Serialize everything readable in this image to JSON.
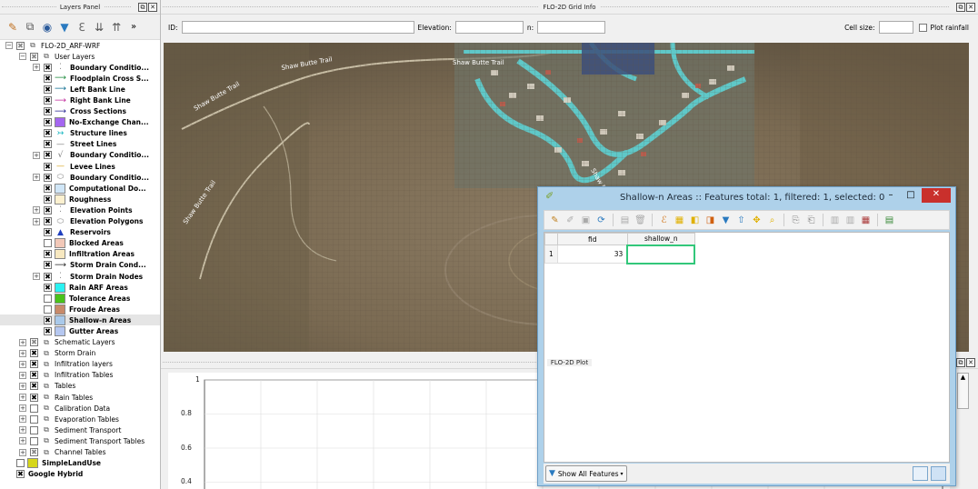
{
  "layers_panel": {
    "title": "Layers Panel",
    "tree": [
      {
        "label": "FLO-2D_ARF-WRF",
        "level": 0,
        "expander": "⊟",
        "check": "☒",
        "kind": "group",
        "bold": false
      },
      {
        "label": "User Layers",
        "level": 1,
        "expander": "⊟",
        "check": "☒",
        "kind": "group",
        "bold": false
      },
      {
        "label": "Boundary Conditio...",
        "level": 2,
        "expander": "⊞",
        "check": "✖",
        "kind": "layer",
        "symbol": "⁚",
        "symbol_color": "#888888",
        "bold": true
      },
      {
        "label": "Floodplain Cross S...",
        "level": 2,
        "expander": "",
        "check": "✖",
        "kind": "layer",
        "symbol": "⟶",
        "symbol_color": "#1a8a3a",
        "bold": true
      },
      {
        "label": "Left Bank Line",
        "level": 2,
        "expander": "",
        "check": "✖",
        "kind": "layer",
        "symbol": "⟶",
        "symbol_color": "#0b6b8f",
        "bold": true
      },
      {
        "label": "Right Bank Line",
        "level": 2,
        "expander": "",
        "check": "✖",
        "kind": "layer",
        "symbol": "⟶",
        "symbol_color": "#c0259a",
        "bold": true
      },
      {
        "label": "Cross Sections",
        "level": 2,
        "expander": "",
        "check": "✖",
        "kind": "layer",
        "symbol": "⟶",
        "symbol_color": "#1e1e8c",
        "bold": true
      },
      {
        "label": "No-Exchange Chan...",
        "level": 2,
        "expander": "",
        "check": "✖",
        "kind": "swatch",
        "symbol_color": "#a466f0",
        "bold": true
      },
      {
        "label": "Structure lines",
        "level": 2,
        "expander": "",
        "check": "✖",
        "kind": "layer",
        "symbol": "↣",
        "symbol_color": "#15b5c0",
        "bold": true
      },
      {
        "label": "Street Lines",
        "level": 2,
        "expander": "",
        "check": "✖",
        "kind": "layer",
        "symbol": "—",
        "symbol_color": "#777777",
        "bold": true
      },
      {
        "label": "Boundary Conditio...",
        "level": 2,
        "expander": "⊞",
        "check": "✖",
        "kind": "layer",
        "symbol": "√",
        "symbol_color": "#777777",
        "bold": true
      },
      {
        "label": "Levee Lines",
        "level": 2,
        "expander": "",
        "check": "✖",
        "kind": "layer",
        "symbol": "—",
        "symbol_color": "#d4a017",
        "bold": true
      },
      {
        "label": "Boundary Conditio...",
        "level": 2,
        "expander": "⊞",
        "check": "✖",
        "kind": "layer",
        "symbol": "⬭",
        "symbol_color": "#888888",
        "bold": true
      },
      {
        "label": "Computational Do...",
        "level": 2,
        "expander": "",
        "check": "✖",
        "kind": "swatch",
        "symbol_color": "#d0e6f7",
        "bold": true
      },
      {
        "label": "Roughness",
        "level": 2,
        "expander": "",
        "check": "✖",
        "kind": "swatch",
        "symbol_color": "#fdf1d0",
        "bold": true
      },
      {
        "label": "Elevation Points",
        "level": 2,
        "expander": "⊞",
        "check": "✖",
        "kind": "layer",
        "symbol": "⁚",
        "symbol_color": "#888888",
        "bold": true
      },
      {
        "label": "Elevation Polygons",
        "level": 2,
        "expander": "⊞",
        "check": "✖",
        "kind": "layer",
        "symbol": "⬭",
        "symbol_color": "#888888",
        "bold": true
      },
      {
        "label": "Reservoirs",
        "level": 2,
        "expander": "",
        "check": "✖",
        "kind": "layer",
        "symbol": "▲",
        "symbol_color": "#1f3fbf",
        "bold": true
      },
      {
        "label": "Blocked Areas",
        "level": 2,
        "expander": "",
        "check": "",
        "kind": "swatch",
        "symbol_color": "#f2c8b8",
        "bold": true
      },
      {
        "label": "Infiltration Areas",
        "level": 2,
        "expander": "",
        "check": "✖",
        "kind": "swatch",
        "symbol_color": "#f7e8c0",
        "bold": true
      },
      {
        "label": "Storm Drain Cond...",
        "level": 2,
        "expander": "",
        "check": "✖",
        "kind": "layer",
        "symbol": "⟶",
        "symbol_color": "#222222",
        "bold": true
      },
      {
        "label": "Storm Drain Nodes",
        "level": 2,
        "expander": "⊞",
        "check": "✖",
        "kind": "layer",
        "symbol": "⁚",
        "symbol_color": "#888888",
        "bold": true
      },
      {
        "label": "Rain ARF Areas",
        "level": 2,
        "expander": "",
        "check": "✖",
        "kind": "swatch",
        "symbol_color": "#2af2f2",
        "bold": true
      },
      {
        "label": "Tolerance Areas",
        "level": 2,
        "expander": "",
        "check": "",
        "kind": "swatch",
        "symbol_color": "#49c21a",
        "bold": true
      },
      {
        "label": "Froude Areas",
        "level": 2,
        "expander": "",
        "check": "",
        "kind": "swatch",
        "symbol_color": "#c88a6a",
        "bold": true
      },
      {
        "label": "Shallow-n Areas",
        "level": 2,
        "expander": "",
        "check": "✖",
        "kind": "swatch",
        "symbol_color": "#a9c9ea",
        "bold": true,
        "selected": true
      },
      {
        "label": "Gutter Areas",
        "level": 2,
        "expander": "",
        "check": "✖",
        "kind": "swatch",
        "symbol_color": "#b5c7f0",
        "bold": true
      },
      {
        "label": "Schematic Layers",
        "level": 1,
        "expander": "⊞",
        "check": "☒",
        "kind": "group",
        "bold": false
      },
      {
        "label": "Storm Drain",
        "level": 1,
        "expander": "⊞",
        "check": "✖",
        "kind": "group",
        "bold": false
      },
      {
        "label": "Infiltration layers",
        "level": 1,
        "expander": "⊞",
        "check": "✖",
        "kind": "group",
        "bold": false
      },
      {
        "label": "Infiltration Tables",
        "level": 1,
        "expander": "⊞",
        "check": "✖",
        "kind": "group",
        "bold": false
      },
      {
        "label": "Tables",
        "level": 1,
        "expander": "⊞",
        "check": "✖",
        "kind": "group",
        "bold": false
      },
      {
        "label": "Rain Tables",
        "level": 1,
        "expander": "⊞",
        "check": "✖",
        "kind": "group",
        "bold": false
      },
      {
        "label": "Calibration Data",
        "level": 1,
        "expander": "⊞",
        "check": "",
        "kind": "group",
        "bold": false
      },
      {
        "label": "Evaporation Tables",
        "level": 1,
        "expander": "⊞",
        "check": "",
        "kind": "group",
        "bold": false
      },
      {
        "label": "Sediment Transport",
        "level": 1,
        "expander": "⊞",
        "check": "",
        "kind": "group",
        "bold": false
      },
      {
        "label": "Sediment Transport Tables",
        "level": 1,
        "expander": "⊞",
        "check": "",
        "kind": "group",
        "bold": false
      },
      {
        "label": "Channel Tables",
        "level": 1,
        "expander": "⊞",
        "check": "☒",
        "kind": "group",
        "bold": false
      },
      {
        "label": "SimpleLandUse",
        "level": 0,
        "expander": "",
        "check": "",
        "kind": "swatch",
        "symbol_color": "#d6d61a",
        "bold": true
      },
      {
        "label": "Google Hybrid",
        "level": 0,
        "expander": "",
        "check": "✖",
        "kind": "none",
        "bold": true
      }
    ]
  },
  "grid_info": {
    "title": "FLO-2D Grid Info",
    "id_label": "ID:",
    "elevation_label": "Elevation:",
    "n_label": "n:",
    "cell_size_label": "Cell size:",
    "plot_rainfall_label": "Plot rainfall",
    "id_value": "",
    "elevation_value": "",
    "n_value": "",
    "cell_size_value": ""
  },
  "map": {
    "labels": [
      "Shaw Butte Trail",
      "Shaw Butte Trail",
      "Shaw Butte Trail",
      "Shaw Butte Trail",
      "Shaw Butte Trail"
    ]
  },
  "plot": {
    "title": "FLO-2D Plot",
    "y_ticks": [
      "1",
      "0.8",
      "0.6",
      "0.4"
    ]
  },
  "attribute_table": {
    "title": "Shallow-n Areas :: Features total: 1, filtered: 1, selected: 0",
    "columns": [
      "fid",
      "shallow_n"
    ],
    "rows": [
      {
        "row_no": "1",
        "fid": "33",
        "shallow_n": ""
      }
    ],
    "show_all_label": "Show All Features",
    "minimize": "–",
    "maximize": "□",
    "close": "✕"
  }
}
